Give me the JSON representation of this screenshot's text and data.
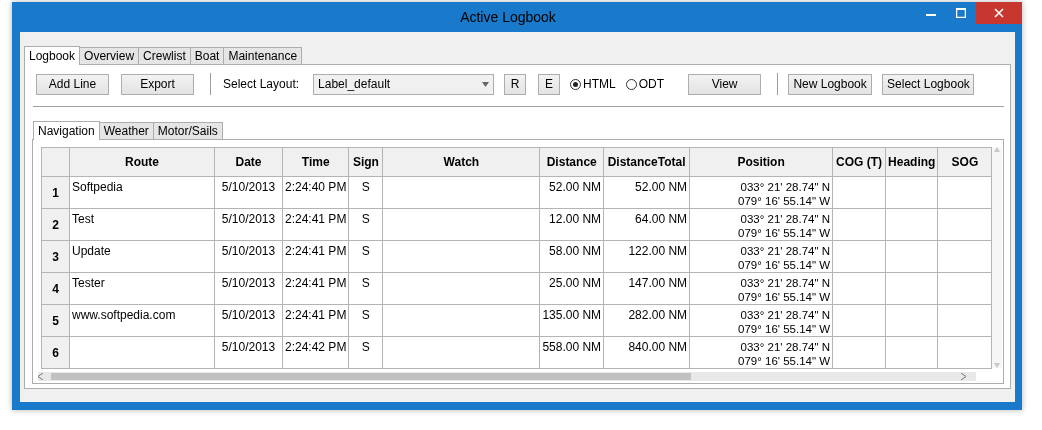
{
  "window": {
    "title": "Active Logbook"
  },
  "tabs": [
    {
      "label": "Logbook",
      "selected": true
    },
    {
      "label": "Overview",
      "selected": false
    },
    {
      "label": "Crewlist",
      "selected": false
    },
    {
      "label": "Boat",
      "selected": false
    },
    {
      "label": "Maintenance",
      "selected": false
    }
  ],
  "toolbar": {
    "add_line": "Add Line",
    "export": "Export",
    "layout_label": "Select Layout:",
    "layout_value": "Label_default",
    "r": "R",
    "e": "E",
    "formats": [
      {
        "label": "HTML",
        "selected": true
      },
      {
        "label": "ODT",
        "selected": false
      }
    ],
    "view": "View",
    "new_logbook": "New Logbook",
    "select_logbook": "Select Logbook"
  },
  "sub_tabs": [
    {
      "label": "Navigation",
      "selected": true
    },
    {
      "label": "Weather",
      "selected": false
    },
    {
      "label": "Motor/Sails",
      "selected": false
    }
  ],
  "table": {
    "columns": [
      "Route",
      "Date",
      "Time",
      "Sign",
      "Watch",
      "Distance",
      "DistanceTotal",
      "Position",
      "COG (T)",
      "Heading",
      "SOG"
    ],
    "rows": [
      {
        "number": "1",
        "cells": [
          "Softpedia",
          "5/10/2013",
          "2:24:40 PM",
          "S",
          "",
          "52.00 NM",
          "52.00 NM",
          "033° 21' 28.74\" N\n079° 16' 55.14\" W",
          "",
          "",
          ""
        ]
      },
      {
        "number": "2",
        "cells": [
          "Test",
          "5/10/2013",
          "2:24:41 PM",
          "S",
          "",
          "12.00 NM",
          "64.00 NM",
          "033° 21' 28.74\" N\n079° 16' 55.14\" W",
          "",
          "",
          ""
        ]
      },
      {
        "number": "3",
        "cells": [
          "Update",
          "5/10/2013",
          "2:24:41 PM",
          "S",
          "",
          "58.00 NM",
          "122.00 NM",
          "033° 21' 28.74\" N\n079° 16' 55.14\" W",
          "",
          "",
          ""
        ]
      },
      {
        "number": "4",
        "cells": [
          "Tester",
          "5/10/2013",
          "2:24:41 PM",
          "S",
          "",
          "25.00 NM",
          "147.00 NM",
          "033° 21' 28.74\" N\n079° 16' 55.14\" W",
          "",
          "",
          ""
        ]
      },
      {
        "number": "5",
        "cells": [
          "www.softpedia.com",
          "5/10/2013",
          "2:24:41 PM",
          "S",
          "",
          "135.00 NM",
          "282.00 NM",
          "033° 21' 28.74\" N\n079° 16' 55.14\" W",
          "",
          "",
          ""
        ]
      },
      {
        "number": "6",
        "cells": [
          "",
          "5/10/2013",
          "2:24:42 PM",
          "S",
          "",
          "558.00 NM",
          "840.00 NM",
          "033° 21' 28.74\" N\n079° 16' 55.14\" W",
          "",
          "",
          ""
        ]
      }
    ]
  }
}
